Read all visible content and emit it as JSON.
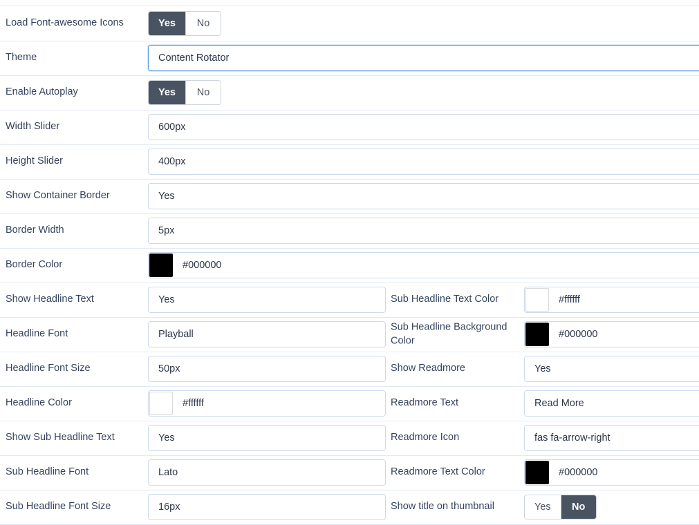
{
  "form": {
    "toggle_options": {
      "yes": "Yes",
      "no": "No"
    },
    "rows_full": [
      {
        "label": "Load Font-awesome Icons",
        "type": "toggle",
        "active": "yes"
      },
      {
        "label": "Theme",
        "type": "text",
        "value": "Content Rotator",
        "focused": true
      },
      {
        "label": "Enable Autoplay",
        "type": "toggle",
        "active": "yes"
      },
      {
        "label": "Width Slider",
        "type": "text",
        "value": "600px"
      },
      {
        "label": "Height Slider",
        "type": "text",
        "value": "400px"
      },
      {
        "label": "Show Container Border",
        "type": "text",
        "value": "Yes"
      },
      {
        "label": "Border Width",
        "type": "text",
        "value": "5px"
      },
      {
        "label": "Border Color",
        "type": "color",
        "value": "#000000",
        "swatch": "#000000"
      }
    ],
    "rows_left": [
      {
        "label": "Show Headline Text",
        "type": "text",
        "value": "Yes"
      },
      {
        "label": "Headline Font",
        "type": "text",
        "value": "Playball"
      },
      {
        "label": "Headline Font Size",
        "type": "text",
        "value": "50px"
      },
      {
        "label": "Headline Color",
        "type": "color",
        "value": "#ffffff",
        "swatch": "#ffffff"
      },
      {
        "label": "Show Sub Headline Text",
        "type": "text",
        "value": "Yes"
      },
      {
        "label": "Sub Headline Font",
        "type": "text",
        "value": "Lato"
      },
      {
        "label": "Sub Headline Font Size",
        "type": "text",
        "value": "16px"
      }
    ],
    "rows_right": [
      {
        "label": "Sub Headline Text Color",
        "type": "color",
        "value": "#ffffff",
        "swatch": "#ffffff"
      },
      {
        "label": "Sub Headline Background Color",
        "type": "color",
        "value": "#000000",
        "swatch": "#000000"
      },
      {
        "label": "Show Readmore",
        "type": "text",
        "value": "Yes"
      },
      {
        "label": "Readmore Text",
        "type": "text",
        "value": "Read More"
      },
      {
        "label": "Readmore Icon",
        "type": "text",
        "value": "fas fa-arrow-right"
      },
      {
        "label": "Readmore Text Color",
        "type": "color",
        "value": "#000000",
        "swatch": "#000000"
      },
      {
        "label": "Show title on thumbnail",
        "type": "toggle",
        "active": "no"
      }
    ]
  },
  "colors": {
    "label_text": "#36435c",
    "value_text": "#2c3648",
    "input_border": "#ccd9ec",
    "input_border_focus": "#4d9ae8",
    "toggle_active_bg": "#4a5361",
    "divider": "#e3e9f2"
  }
}
